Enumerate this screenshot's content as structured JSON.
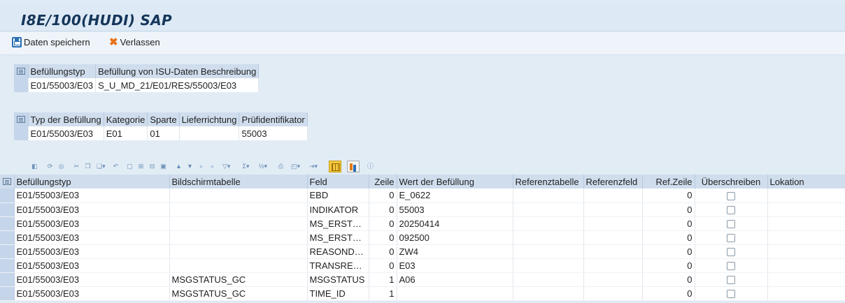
{
  "title": "I8E/100(HUDI) SAP",
  "toolbar": {
    "save_label": "Daten speichern",
    "exit_label": "Verlassen"
  },
  "section1": {
    "headers": [
      "Befüllungstyp",
      "Befüllung von ISU-Daten Beschreibung"
    ],
    "row": [
      "E01/55003/E03",
      "S_U_MD_21/E01/RES/55003/E03"
    ]
  },
  "section2": {
    "headers": [
      "Typ der Befüllung",
      "Kategorie",
      "Sparte",
      "Lieferrichtung",
      "Prüfidentifikator"
    ],
    "row": [
      "E01/55003/E03",
      "E01",
      "01",
      "",
      "55003"
    ]
  },
  "table": {
    "headers": [
      "Befüllungstyp",
      "Bildschirmtabelle",
      "Feld",
      "Zeile",
      "Wert der Befüllung",
      "Referenztabelle",
      "Referenzfeld",
      "Ref.Zeile",
      "Überschreiben",
      "Lokation"
    ],
    "rows": [
      [
        "E01/55003/E03",
        "",
        "EBD",
        "0",
        "E_0622",
        "",
        "",
        "0"
      ],
      [
        "E01/55003/E03",
        "",
        "INDIKATOR",
        "0",
        "55003",
        "",
        "",
        "0"
      ],
      [
        "E01/55003/E03",
        "",
        "MS_ERSTELL...",
        "0",
        "20250414",
        "",
        "",
        "0"
      ],
      [
        "E01/55003/E03",
        "",
        "MS_ERSTELL...",
        "0",
        "092500",
        "",
        "",
        "0"
      ],
      [
        "E01/55003/E03",
        "",
        "REASONDET...",
        "0",
        "ZW4",
        "",
        "",
        "0"
      ],
      [
        "E01/55003/E03",
        "",
        "TRANSREAS...",
        "0",
        "E03",
        "",
        "",
        "0"
      ],
      [
        "E01/55003/E03",
        "MSGSTATUS_GC",
        "MSGSTATUS",
        "1",
        "A06",
        "",
        "",
        "0"
      ],
      [
        "E01/55003/E03",
        "MSGSTATUS_GC",
        "TIME_ID",
        "1",
        "",
        "",
        "",
        "0"
      ]
    ]
  }
}
